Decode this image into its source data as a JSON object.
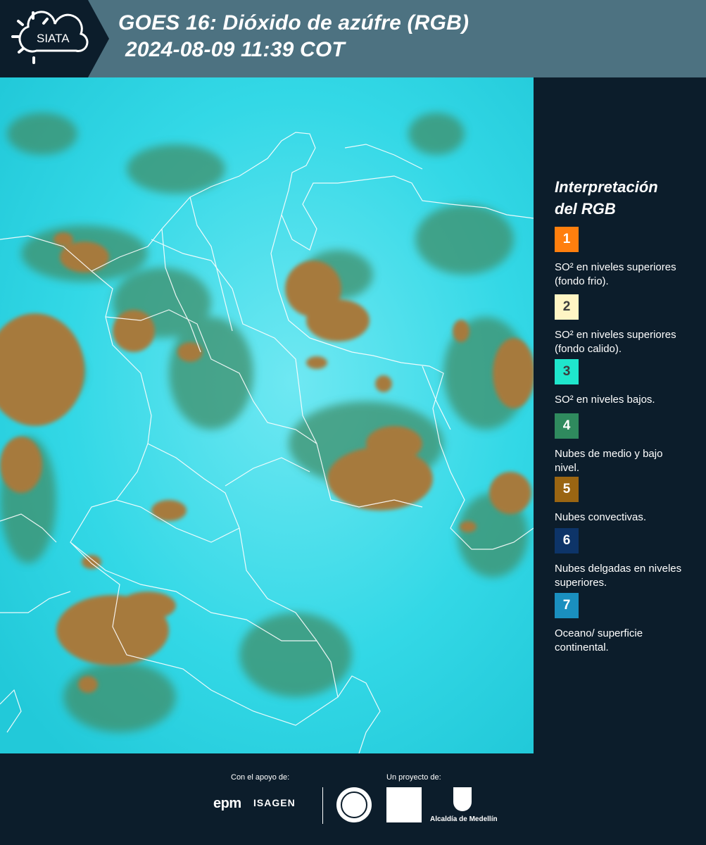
{
  "header": {
    "logo_text": "SIATA",
    "title_line1": "GOES 16: Dióxido de azúfre (RGB)",
    "title_line2": "2024-08-09 11:39 COT",
    "background_color": "#4d7281"
  },
  "map": {
    "base_color": "#2fd6e4",
    "convective_color": "#a67a3c",
    "low_cloud_color": "#3d8a6c"
  },
  "legend": {
    "title_line1": "Interpretación",
    "title_line2": "del RGB",
    "items": [
      {
        "number": "1",
        "color": "#ff7f0e",
        "label": "SO² en niveles superiores (fondo frio)."
      },
      {
        "number": "2",
        "color": "#fff5c4",
        "label": "SO² en niveles superiores (fondo calido)."
      },
      {
        "number": "3",
        "color": "#1fe6cc",
        "label": "SO² en niveles bajos."
      },
      {
        "number": "4",
        "color": "#2f8a5e",
        "label": "Nubes de medio y bajo nivel."
      },
      {
        "number": "5",
        "color": "#9a6512",
        "label": "Nubes convectivas."
      },
      {
        "number": "6",
        "color": "#0d3468",
        "label": "Nubes delgadas en niveles superiores."
      },
      {
        "number": "7",
        "color": "#1a8fbf",
        "label": "Oceano/ superficie continental."
      }
    ]
  },
  "footer": {
    "support_label": "Con el apoyo de:",
    "project_label": "Un proyecto de:",
    "epm": "epm",
    "isagen": "ISAGEN",
    "alcaldia": "Alcaldía de Medellín"
  }
}
